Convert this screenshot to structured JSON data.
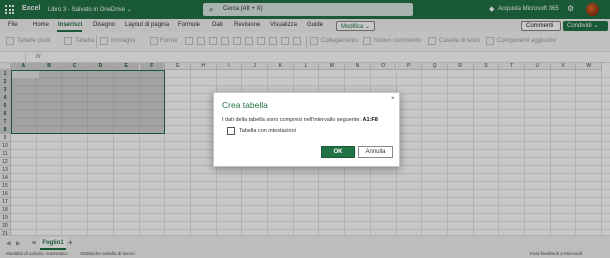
{
  "titlebar": {
    "app_name": "Excel",
    "document": "Libro 3 - Salvato in OneDrive ⌄",
    "search_placeholder": "Cerca (Alt + X)",
    "premium": "Acquista Microsoft 365",
    "background_color": "#217346"
  },
  "menu": {
    "items": [
      "File",
      "Home",
      "Inserisci",
      "Disegno",
      "Layout di pagina",
      "Formule",
      "Dati",
      "Revisione",
      "Visualizza",
      "Guide"
    ],
    "active": "Inserisci",
    "edit_mode": "Modifica ⌄",
    "comments": "Commenti",
    "share": "Condividi ⌄"
  },
  "ribbon": {
    "items": [
      "Tabelle pivot",
      "Tabella",
      "Immagini",
      "Forme",
      "Collegamento",
      "Nuovo commento",
      "Casella di testo",
      "Componenti aggiuntivi"
    ]
  },
  "grid": {
    "columns": [
      "A",
      "B",
      "C",
      "D",
      "E",
      "F",
      "G",
      "H",
      "I",
      "J",
      "K",
      "L",
      "M",
      "N",
      "O",
      "P",
      "Q",
      "R",
      "S",
      "T",
      "U",
      "V",
      "W"
    ],
    "rows": [
      "1",
      "2",
      "3",
      "4",
      "5",
      "6",
      "7",
      "8",
      "9",
      "10",
      "11",
      "12",
      "13",
      "14",
      "15",
      "16",
      "17",
      "18",
      "19",
      "20",
      "21",
      "22",
      "23"
    ],
    "selected_range": "A1:F8"
  },
  "dialog": {
    "title": "Crea tabella",
    "close": "×",
    "message": "I dati della tabella sono compresi nell'intervallo seguente:",
    "range": "A1:F8",
    "checkbox_label": "Tabella con intestazioni",
    "checkbox_checked": false,
    "ok": "OK",
    "cancel": "Annulla"
  },
  "sheets": {
    "tabs": [
      "Foglio1"
    ],
    "add": "+"
  },
  "statusbar": {
    "calc_mode": "Modalità di calcolo: Automatico",
    "stats": "Statistiche cartella di lavoro",
    "feedback": "Invia feedback a Microsoft"
  }
}
